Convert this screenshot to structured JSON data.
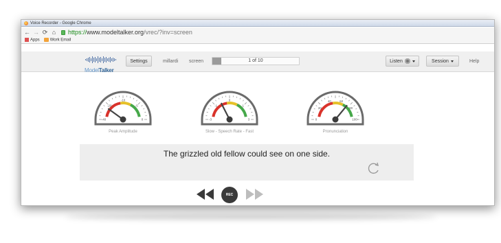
{
  "browser": {
    "window_title": "Voice Recorder - Google Chrome",
    "url_scheme": "https://",
    "url_host": "www.modeltalker.org",
    "url_path": "/vrec/?inv=screen",
    "bookmarks": [
      {
        "label": "Apps",
        "icon": "apps-grid-icon"
      },
      {
        "label": "Work Email",
        "icon": "office-mail-icon"
      }
    ]
  },
  "header": {
    "logo_text_a": "Model",
    "logo_text_b": "Talker",
    "settings_label": "Settings",
    "user": "millardi",
    "mode": "screen",
    "progress_text": "1 of 10",
    "progress_fraction": 0.1,
    "listen_label": "Listen",
    "session_label": "Session",
    "help_label": "Help"
  },
  "gauges": [
    {
      "label": "Peak Amplitude",
      "scale": [
        "-40",
        "-20",
        "-10",
        "-5",
        "0"
      ],
      "needle_fraction": 0.2
    },
    {
      "label": "Slow - Speech Rate - Fast",
      "scale": [
        "-3",
        "-1",
        "0",
        "1",
        "3"
      ],
      "needle_fraction": 0.35
    },
    {
      "label": "Pronunciation",
      "scale": [
        "0",
        "20",
        "40",
        "60",
        "80",
        "100"
      ],
      "needle_fraction": 0.72
    }
  ],
  "prompt": {
    "sentence": "The grizzled old fellow could see on one side."
  },
  "controls": {
    "rec_label": "REC",
    "prev_icon": "rewind-icon",
    "next_icon": "fast-forward-icon",
    "redo_icon": "refresh-icon"
  },
  "colors": {
    "accent_blue": "#336699",
    "gauge_red": "#d9332b",
    "gauge_yellow": "#e6c12a",
    "gauge_green": "#46a84a"
  }
}
